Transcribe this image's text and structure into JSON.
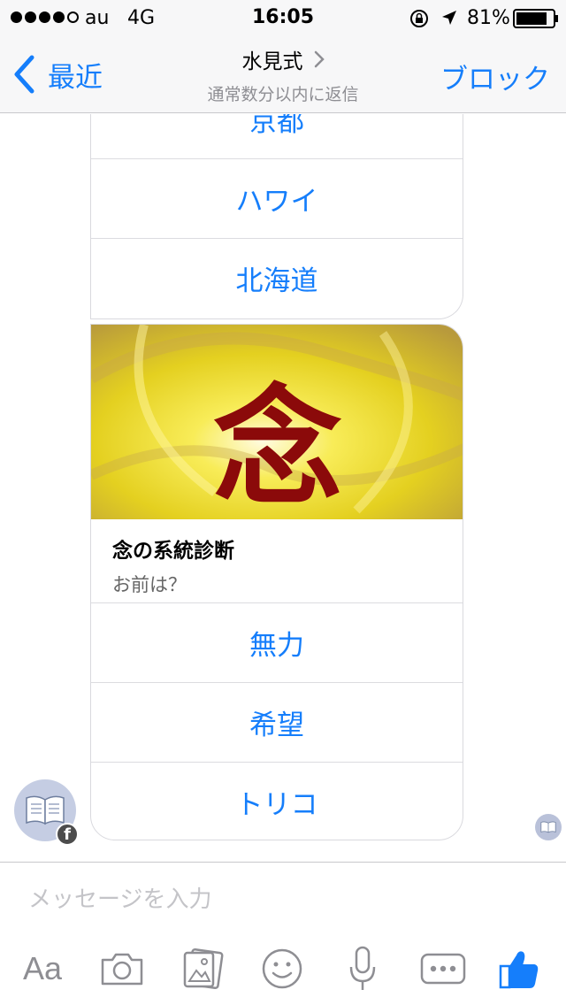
{
  "status_bar": {
    "carrier": "au",
    "network": "4G",
    "time": "16:05",
    "battery_percent": "81%",
    "signal_bars": 4
  },
  "nav": {
    "back_label": "最近",
    "title": "水見式",
    "subtitle": "通常数分以内に返信",
    "block_label": "ブロック"
  },
  "card_top": {
    "buttons": [
      "京都",
      "ハワイ",
      "北海道"
    ]
  },
  "card_main": {
    "image_text": "念",
    "title": "念の系統診断",
    "subtitle": "お前は？",
    "buttons": [
      "無力",
      "希望",
      "トリコ"
    ]
  },
  "composer": {
    "placeholder": "メッセージを入力",
    "aa_label": "Aa"
  },
  "icons": [
    "back-chevron-icon",
    "chevron-right-icon",
    "camera-icon",
    "photo-icon",
    "emoji-icon",
    "microphone-icon",
    "more-icon",
    "like-icon",
    "book-icon",
    "facebook-icon"
  ],
  "colors": {
    "accent": "#157efb",
    "placeholder": "#c4c4c8",
    "icon_gray": "#8e8e93",
    "image_kanji": "#8b0a0a",
    "image_bg": "#e8d82a"
  }
}
